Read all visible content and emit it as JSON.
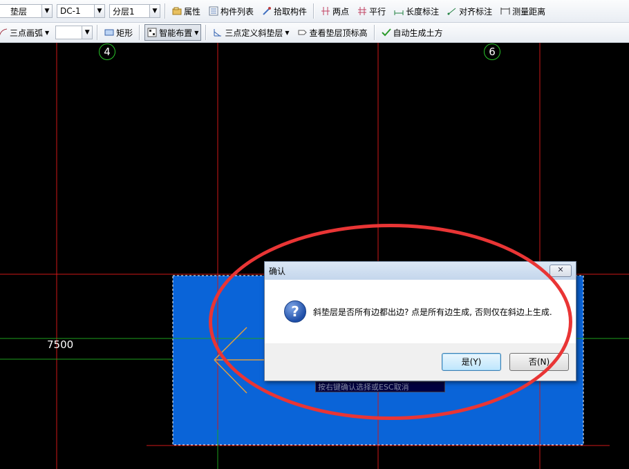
{
  "toolbar1": {
    "layer_select": "垫层",
    "component_select": "DC-1",
    "floor_select": "分层1",
    "buttons": {
      "properties": "属性",
      "component_list": "构件列表",
      "pick_component": "拾取构件",
      "two_points": "两点",
      "parallel": "平行",
      "length_dim": "长度标注",
      "align_dim": "对齐标注",
      "measure_distance": "测量距离"
    }
  },
  "toolbar2": {
    "arc_tool": "三点画弧",
    "arc_combo_value": "",
    "rectangle": "矩形",
    "smart_layout": "智能布置",
    "three_point_slope": "三点定义斜垫层",
    "view_top_elevation": "查看垫层顶标高",
    "auto_earthwork": "自动生成土方"
  },
  "canvas": {
    "axis_labels": [
      "4",
      "6"
    ],
    "dimension_text": "7500",
    "command_prompt": "按右键确认选择或ESC取消",
    "colors": {
      "background": "#000000",
      "grid_red": "#d01818",
      "grid_green": "#1ea01e",
      "slab_fill": "#0a64d8",
      "arrow": "#e0a040"
    }
  },
  "dialog": {
    "title": "确认",
    "close_icon": "close-icon",
    "message": "斜垫层是否所有边都出边? 点是所有边生成, 否则仅在斜边上生成.",
    "yes_label": "是(Y)",
    "no_label": "否(N)"
  },
  "annotation": {
    "highlight_color": "#e93535"
  }
}
